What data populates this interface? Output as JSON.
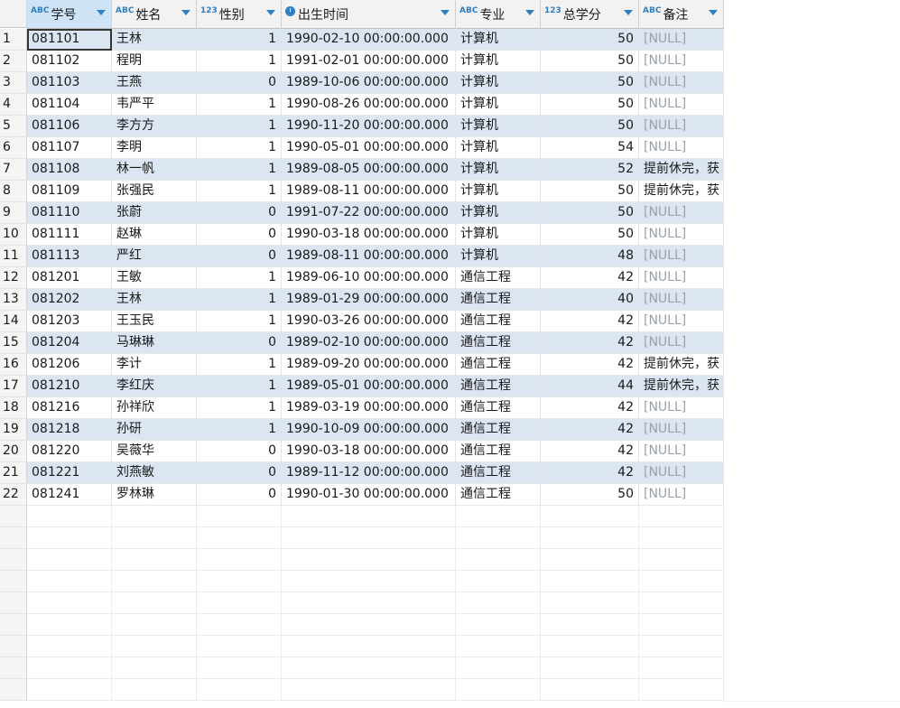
{
  "columns": [
    {
      "name": "学号",
      "type_tag": "ABC"
    },
    {
      "name": "姓名",
      "type_tag": "ABC"
    },
    {
      "name": "性别",
      "type_tag": "123"
    },
    {
      "name": "出生时间",
      "type_tag": "clock"
    },
    {
      "name": "专业",
      "type_tag": "ABC"
    },
    {
      "name": "总学分",
      "type_tag": "123"
    },
    {
      "name": "备注",
      "type_tag": "ABC"
    }
  ],
  "rows": [
    [
      "081101",
      "王林",
      "1",
      "1990-02-10 00:00:00.000",
      "计算机",
      "50",
      "[NULL]"
    ],
    [
      "081102",
      "程明",
      "1",
      "1991-02-01 00:00:00.000",
      "计算机",
      "50",
      "[NULL]"
    ],
    [
      "081103",
      "王燕",
      "0",
      "1989-10-06 00:00:00.000",
      "计算机",
      "50",
      "[NULL]"
    ],
    [
      "081104",
      "韦严平",
      "1",
      "1990-08-26 00:00:00.000",
      "计算机",
      "50",
      "[NULL]"
    ],
    [
      "081106",
      "李方方",
      "1",
      "1990-11-20 00:00:00.000",
      "计算机",
      "50",
      "[NULL]"
    ],
    [
      "081107",
      "李明",
      "1",
      "1990-05-01 00:00:00.000",
      "计算机",
      "54",
      "[NULL]"
    ],
    [
      "081108",
      "林一帆",
      "1",
      "1989-08-05 00:00:00.000",
      "计算机",
      "52",
      "提前休完，获"
    ],
    [
      "081109",
      "张强民",
      "1",
      "1989-08-11 00:00:00.000",
      "计算机",
      "50",
      "提前休完，获"
    ],
    [
      "081110",
      "张蔚",
      "0",
      "1991-07-22 00:00:00.000",
      "计算机",
      "50",
      "[NULL]"
    ],
    [
      "081111",
      "赵琳",
      "0",
      "1990-03-18 00:00:00.000",
      "计算机",
      "50",
      "[NULL]"
    ],
    [
      "081113",
      "严红",
      "0",
      "1989-08-11 00:00:00.000",
      "计算机",
      "48",
      "[NULL]"
    ],
    [
      "081201",
      "王敏",
      "1",
      "1989-06-10 00:00:00.000",
      "通信工程",
      "42",
      "[NULL]"
    ],
    [
      "081202",
      "王林",
      "1",
      "1989-01-29 00:00:00.000",
      "通信工程",
      "40",
      "[NULL]"
    ],
    [
      "081203",
      "王玉民",
      "1",
      "1990-03-26 00:00:00.000",
      "通信工程",
      "42",
      "[NULL]"
    ],
    [
      "081204",
      "马琳琳",
      "0",
      "1989-02-10 00:00:00.000",
      "通信工程",
      "42",
      "[NULL]"
    ],
    [
      "081206",
      "李计",
      "1",
      "1989-09-20 00:00:00.000",
      "通信工程",
      "42",
      "提前休完，获"
    ],
    [
      "081210",
      "李红庆",
      "1",
      "1989-05-01 00:00:00.000",
      "通信工程",
      "44",
      "提前休完，获"
    ],
    [
      "081216",
      "孙祥欣",
      "1",
      "1989-03-19 00:00:00.000",
      "通信工程",
      "42",
      "[NULL]"
    ],
    [
      "081218",
      "孙研",
      "1",
      "1990-10-09 00:00:00.000",
      "通信工程",
      "42",
      "[NULL]"
    ],
    [
      "081220",
      "吴薇华",
      "0",
      "1990-03-18 00:00:00.000",
      "通信工程",
      "42",
      "[NULL]"
    ],
    [
      "081221",
      "刘燕敏",
      "0",
      "1989-11-12 00:00:00.000",
      "通信工程",
      "42",
      "[NULL]"
    ],
    [
      "081241",
      "罗林琳",
      "0",
      "1990-01-30 00:00:00.000",
      "通信工程",
      "50",
      "[NULL]"
    ]
  ],
  "empty_rows": 9,
  "colors": {
    "alt_row": "#dce6f2",
    "header_selected": "#cfe3f7",
    "type_tag": "#2f7fc1",
    "null_text": "#9aa0a8"
  }
}
